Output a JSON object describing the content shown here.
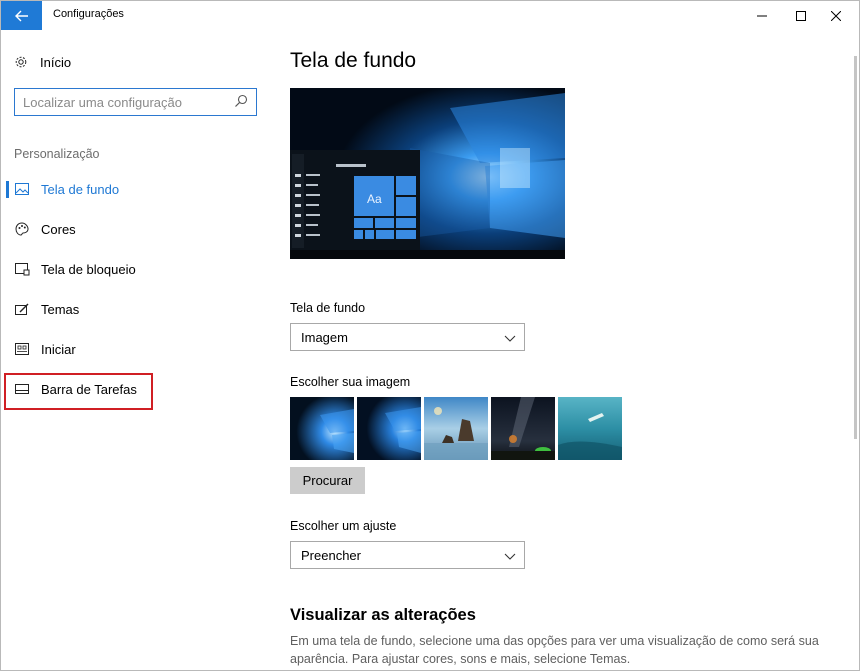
{
  "window": {
    "title": "Configurações",
    "controls": {
      "minimize": "—",
      "maximize": "☐",
      "close": "✕"
    }
  },
  "sidebar": {
    "home_label": "Início",
    "search": {
      "placeholder": "Localizar uma configuração"
    },
    "section_label": "Personalização",
    "items": [
      {
        "label": "Tela de fundo",
        "icon": "picture-icon",
        "active": true
      },
      {
        "label": "Cores",
        "icon": "palette-icon",
        "active": false
      },
      {
        "label": "Tela de bloqueio",
        "icon": "lock-screen-icon",
        "active": false
      },
      {
        "label": "Temas",
        "icon": "brush-icon",
        "active": false
      },
      {
        "label": "Iniciar",
        "icon": "start-grid-icon",
        "active": false
      },
      {
        "label": "Barra de Tarefas",
        "icon": "taskbar-icon",
        "active": false,
        "highlighted": true
      }
    ]
  },
  "main": {
    "title": "Tela de fundo",
    "preview": {
      "tile_label": "Aa"
    },
    "background_field": {
      "label": "Tela de fundo",
      "value": "Imagem"
    },
    "choose_image": {
      "label": "Escolher sua imagem",
      "thumbnails": [
        "windows-hero-blue",
        "windows-hero-blue-2",
        "beach-rocks",
        "night-sky-tent",
        "underwater-swimmer"
      ],
      "browse_label": "Procurar"
    },
    "fit_field": {
      "label": "Escolher um ajuste",
      "value": "Preencher"
    },
    "preview_section": {
      "heading": "Visualizar as alterações",
      "description": "Em uma tela de fundo, selecione uma das opções para ver uma visualização de como será sua aparência. Para ajustar cores, sons e mais, selecione Temas."
    }
  },
  "colors": {
    "accent": "#1e78d4",
    "highlight_border": "#d01f24",
    "title_back_button": "#1f7ad6"
  }
}
